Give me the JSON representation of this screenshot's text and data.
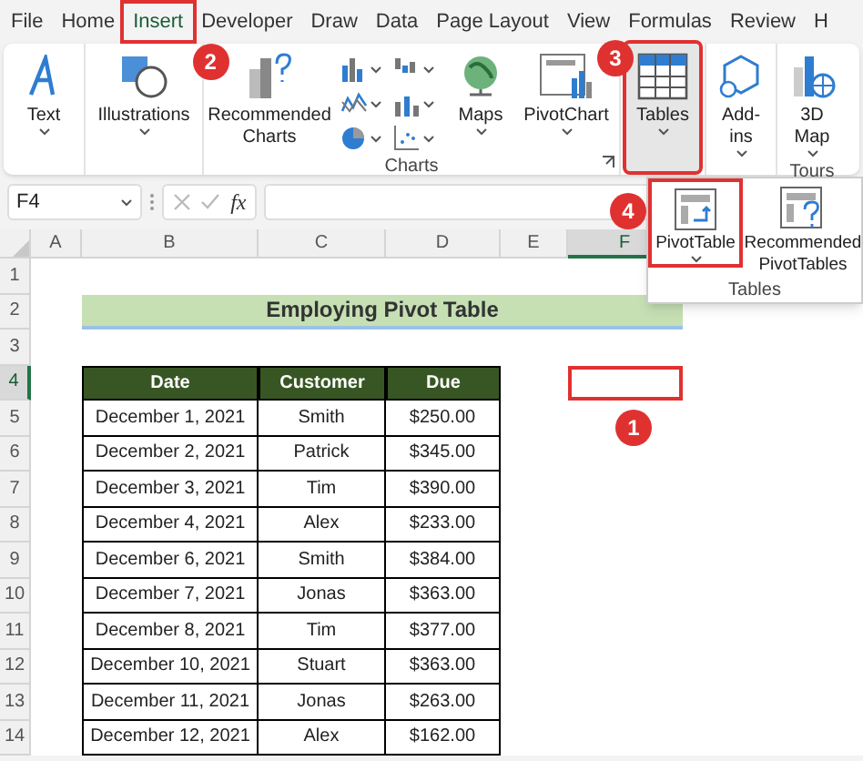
{
  "tabs": [
    {
      "label": "File",
      "selected": false,
      "highlighted": false
    },
    {
      "label": "Home",
      "selected": false,
      "highlighted": false
    },
    {
      "label": "Insert",
      "selected": true,
      "highlighted": true,
      "callout": "2"
    },
    {
      "label": "Developer",
      "selected": false,
      "highlighted": false
    },
    {
      "label": "Draw",
      "selected": false,
      "highlighted": false
    },
    {
      "label": "Data",
      "selected": false,
      "highlighted": false
    },
    {
      "label": "Page Layout",
      "selected": false,
      "highlighted": false
    },
    {
      "label": "View",
      "selected": false,
      "highlighted": false
    },
    {
      "label": "Formulas",
      "selected": false,
      "highlighted": false
    },
    {
      "label": "Review",
      "selected": false,
      "highlighted": false
    },
    {
      "label": "H",
      "selected": false,
      "highlighted": false
    }
  ],
  "ribbon": {
    "groups": [
      {
        "commands": [
          {
            "kind": "text",
            "label": "Text",
            "has_menu": true,
            "highlighted": false
          }
        ]
      },
      {
        "commands": [
          {
            "kind": "illustrations",
            "label": "Illustrations",
            "has_menu": true,
            "highlighted": false
          }
        ]
      },
      {
        "label": "Charts",
        "commands": [
          {
            "kind": "recommended_charts",
            "label": "Recommended Charts",
            "has_menu": false,
            "highlighted": false
          },
          {
            "kind": "chart_grid"
          },
          {
            "kind": "maps",
            "label": "Maps",
            "has_menu": true,
            "highlighted": false
          },
          {
            "kind": "pivot_chart",
            "label": "PivotChart",
            "has_menu": true,
            "highlighted": false
          }
        ]
      },
      {
        "commands": [
          {
            "kind": "tables",
            "label": "Tables",
            "has_menu": true,
            "highlighted": true,
            "callout": "3"
          }
        ]
      },
      {
        "commands": [
          {
            "kind": "addins",
            "label": "Add-ins",
            "has_menu": true,
            "highlighted": false
          }
        ]
      },
      {
        "label": "Tours",
        "commands": [
          {
            "kind": "map3d",
            "label": "3D Map",
            "has_menu": true,
            "highlighted": false
          }
        ]
      }
    ]
  },
  "tables_menu": {
    "items": [
      {
        "kind": "pivot_table",
        "label": "PivotTable",
        "has_menu": true,
        "highlighted": true,
        "callout": "4"
      },
      {
        "kind": "recommended_pivot",
        "label": "Recommended PivotTables",
        "has_menu": false,
        "highlighted": false
      }
    ],
    "label": "Tables"
  },
  "formula_bar": {
    "name_box": "F4",
    "function_button": "fx"
  },
  "sheet": {
    "columns": [
      "A",
      "B",
      "C",
      "D",
      "E",
      "F"
    ],
    "rows": [
      "1",
      "2",
      "3",
      "4",
      "5",
      "6",
      "7",
      "8",
      "9",
      "10",
      "11",
      "12",
      "13",
      "14"
    ],
    "title": "Employing Pivot Table",
    "table": {
      "columns": [
        "Date",
        "Customer",
        "Due"
      ],
      "rows": [
        [
          "December 1, 2021",
          "Smith",
          "$250.00"
        ],
        [
          "December 2, 2021",
          "Patrick",
          "$345.00"
        ],
        [
          "December 3, 2021",
          "Tim",
          "$390.00"
        ],
        [
          "December 4, 2021",
          "Alex",
          "$233.00"
        ],
        [
          "December 6, 2021",
          "Smith",
          "$384.00"
        ],
        [
          "December 7, 2021",
          "Jonas",
          "$363.00"
        ],
        [
          "December 8, 2021",
          "Tim",
          "$377.00"
        ],
        [
          "December 10, 2021",
          "Stuart",
          "$363.00"
        ],
        [
          "December 11, 2021",
          "Jonas",
          "$263.00"
        ],
        [
          "December 12, 2021",
          "Alex",
          "$162.00"
        ]
      ]
    },
    "active_cell_callout": "1"
  }
}
